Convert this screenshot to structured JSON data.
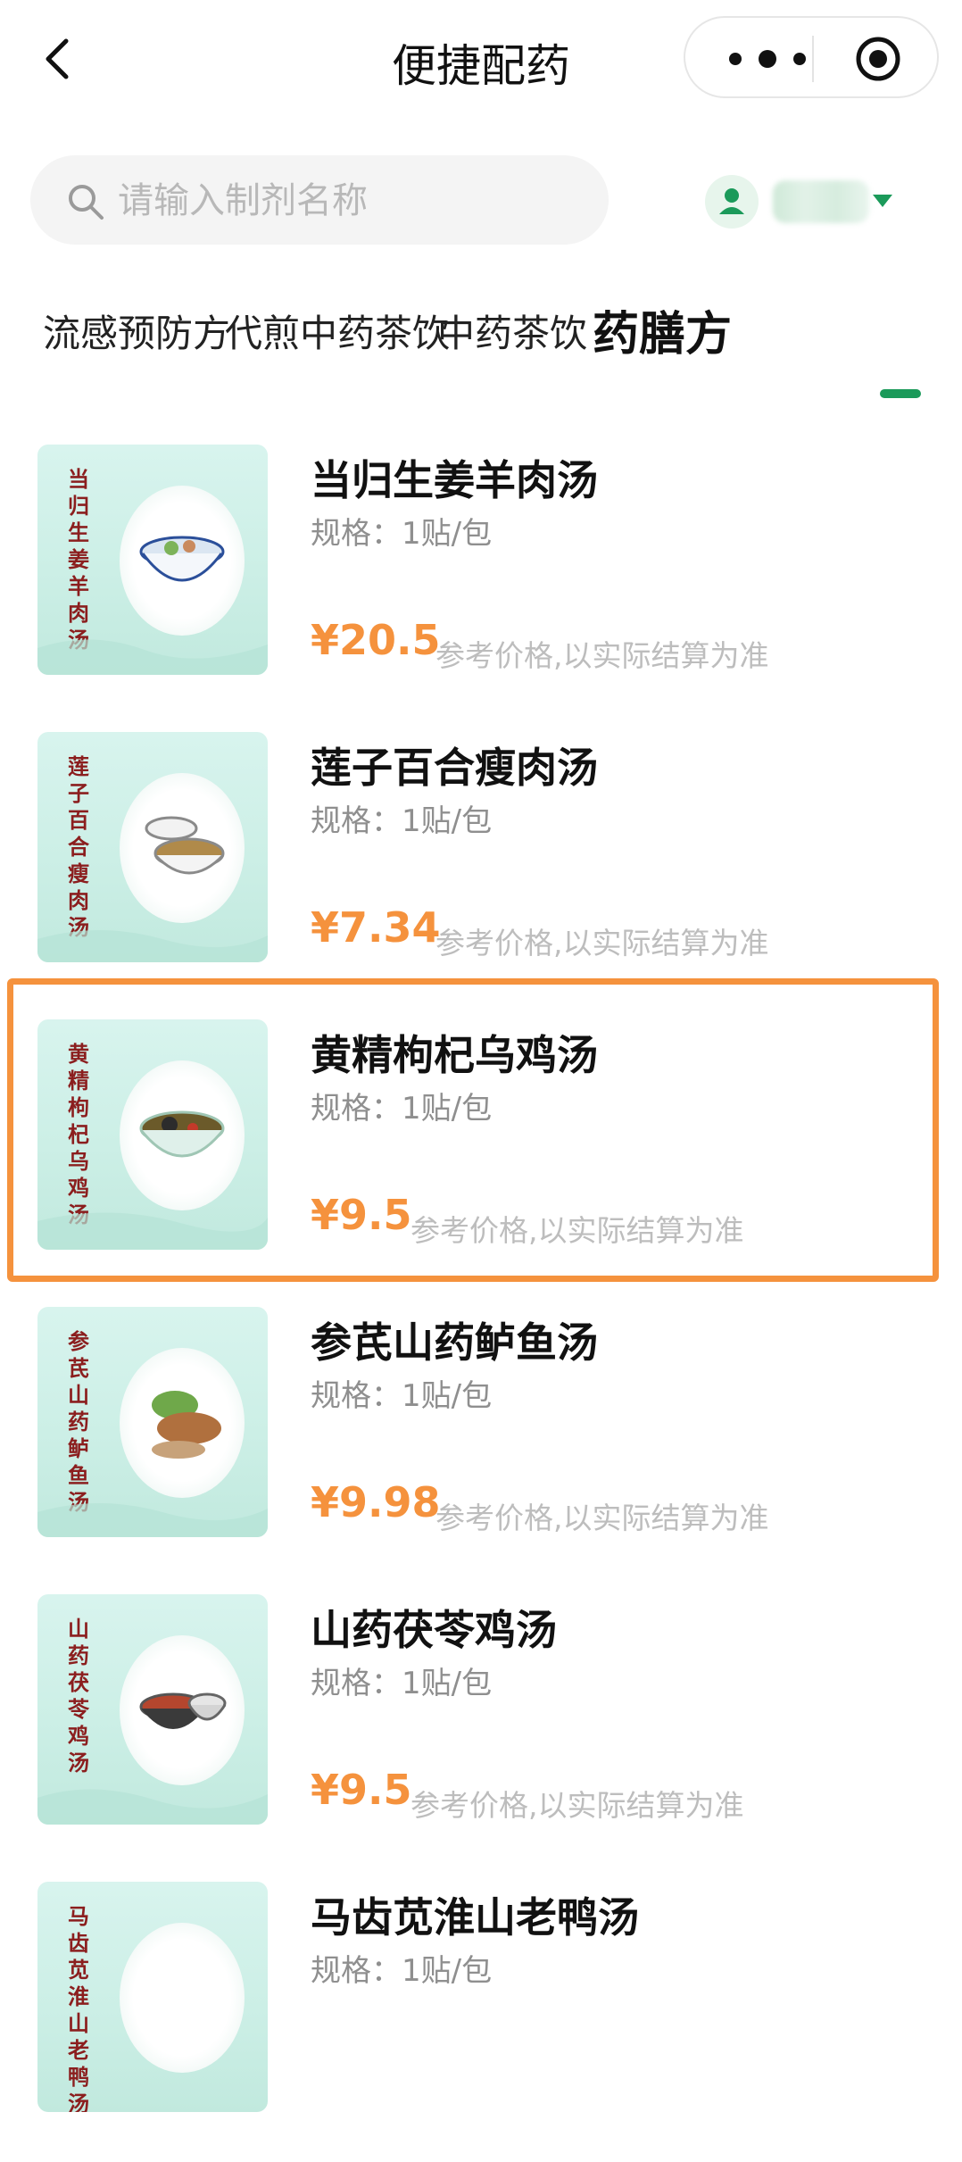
{
  "nav": {
    "title": "便捷配药"
  },
  "search": {
    "placeholder": "请输入制剂名称"
  },
  "tabs": [
    {
      "label": "流感预防方"
    },
    {
      "label": "代煎中药茶饮"
    },
    {
      "label": "中药茶饮"
    },
    {
      "label": "药膳方",
      "active": true
    }
  ],
  "items": [
    {
      "name": "当归生姜羊肉汤",
      "spec": "规格：1贴/包",
      "price": "¥20.5",
      "note": "参考价格,以实际结算为准",
      "thumb_text": "当归生姜羊肉汤"
    },
    {
      "name": "莲子百合瘦肉汤",
      "spec": "规格：1贴/包",
      "price": "¥7.34",
      "note": "参考价格,以实际结算为准",
      "thumb_text": "莲子百合瘦肉汤"
    },
    {
      "name": "黄精枸杞乌鸡汤",
      "spec": "规格：1贴/包",
      "price": "¥9.5",
      "note": "参考价格,以实际结算为准",
      "thumb_text": "黄精枸杞乌鸡汤",
      "highlighted": true
    },
    {
      "name": "参芪山药鲈鱼汤",
      "spec": "规格：1贴/包",
      "price": "¥9.98",
      "note": "参考价格,以实际结算为准",
      "thumb_text": "参芪山药鲈鱼汤"
    },
    {
      "name": "山药茯苓鸡汤",
      "spec": "规格：1贴/包",
      "price": "¥9.5",
      "note": "参考价格,以实际结算为准",
      "thumb_text": "山药茯苓鸡汤"
    },
    {
      "name": "马齿苋淮山老鸭汤",
      "spec": "规格：1贴/包",
      "price": "",
      "note": "",
      "thumb_text": "马齿苋淮山老鸭汤"
    }
  ],
  "colors": {
    "accent_green": "#1b9a5a",
    "price_orange": "#f5923d",
    "highlight_border": "#f5923d"
  }
}
